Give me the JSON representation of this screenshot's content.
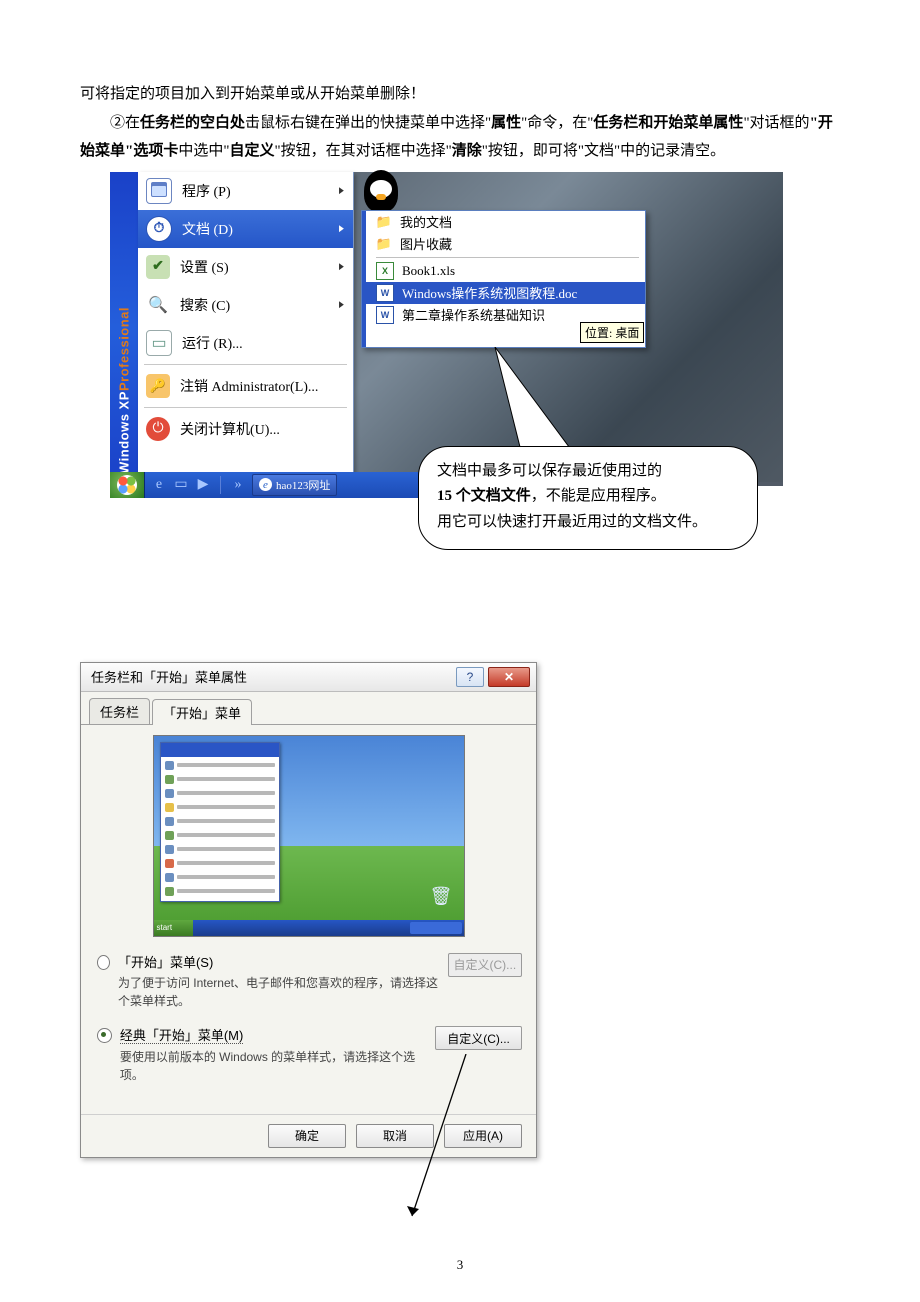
{
  "intro": "可将指定的项目加入到开始菜单或从开始菜单删除！",
  "p2": {
    "prefix": "②在",
    "b1": "任务栏的空白处",
    "seg1": "击鼠标右键在弹出的快捷菜单中选择\"",
    "b2": "属性",
    "seg2": "\"命令，在\"",
    "b3": "任务栏和开始菜单属性",
    "seg3": "\"对话框的",
    "b4": "\"开始菜单\"选项卡",
    "seg4": "中选中\"",
    "b5": "自定义",
    "seg5": "\"按钮，在其对话框中选择\"",
    "b6": "清除",
    "seg6": "\"按钮，即可将\"文档\"中的记录清空。"
  },
  "xp_brand_a": "Windows XP ",
  "xp_brand_b": "Professional",
  "start_menu": {
    "programs": "程序 (P)",
    "documents": "文档 (D)",
    "settings": "设置 (S)",
    "search": "搜索 (C)",
    "run": "运行 (R)...",
    "logoff": "注销 Administrator(L)...",
    "shutdown": "关闭计算机(U)..."
  },
  "taskbar_task": "hao123网址",
  "doc_submenu": {
    "mydocs": "我的文档",
    "pictures": "图片收藏",
    "book": "Book1.xls",
    "tutorial": "Windows操作系统视图教程.doc",
    "chapter": "第二章操作系统基础知识"
  },
  "tooltip": "位置: 桌面",
  "bubble": {
    "l1_a": "文档中最多可以保存最近使用过的",
    "l2_a": "15 个文档文件",
    "l2_b": "，不能是应用程序。",
    "l3": "用它可以快速打开最近用过的文档文件。"
  },
  "dialog": {
    "title": "任务栏和「开始」菜单属性",
    "help": "?",
    "close": "✕",
    "tab_task": "任务栏",
    "tab_start": "「开始」菜单",
    "preview_start": "start",
    "opt1_label": "「开始」菜单(S)",
    "opt1_desc": "为了便于访问 Internet、电子邮件和您喜欢的程序，请选择这个菜单样式。",
    "opt2_label": "经典「开始」菜单(M)",
    "opt2_desc": "要使用以前版本的 Windows 的菜单样式，请选择这个选项。",
    "customize": "自定义(C)...",
    "ok": "确定",
    "cancel": "取消",
    "apply": "应用(A)"
  },
  "page_number": "3"
}
